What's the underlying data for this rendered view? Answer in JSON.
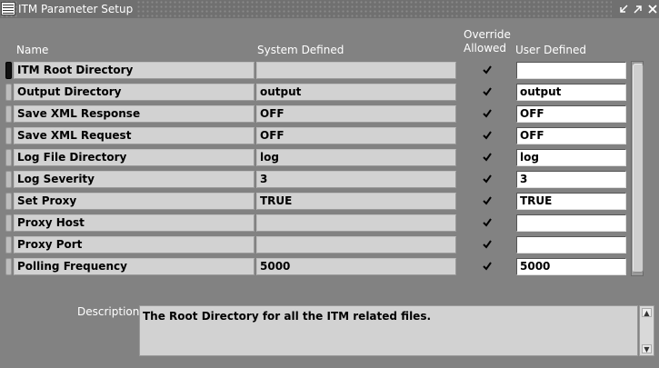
{
  "window": {
    "title": "ITM Parameter Setup",
    "controls": [
      "minimize-icon",
      "maximize-icon",
      "close-icon"
    ]
  },
  "columns": {
    "name": "Name",
    "system": "System Defined",
    "override_line1": "Override",
    "override_line2": "Allowed",
    "user": "User Defined"
  },
  "rows": [
    {
      "name": "ITM Root Directory",
      "system": "",
      "override": true,
      "user": ""
    },
    {
      "name": "Output Directory",
      "system": "output",
      "override": true,
      "user": "output"
    },
    {
      "name": "Save XML Response",
      "system": "OFF",
      "override": true,
      "user": "OFF"
    },
    {
      "name": "Save XML Request",
      "system": "OFF",
      "override": true,
      "user": "OFF"
    },
    {
      "name": "Log File Directory",
      "system": "log",
      "override": true,
      "user": "log"
    },
    {
      "name": "Log Severity",
      "system": "3",
      "override": true,
      "user": "3"
    },
    {
      "name": "Set Proxy",
      "system": "TRUE",
      "override": true,
      "user": "TRUE"
    },
    {
      "name": "Proxy Host",
      "system": "",
      "override": true,
      "user": ""
    },
    {
      "name": "Proxy Port",
      "system": "",
      "override": true,
      "user": ""
    },
    {
      "name": "Polling Frequency",
      "system": "5000",
      "override": true,
      "user": "5000"
    }
  ],
  "description": {
    "label": "Description",
    "text": "The Root Directory for all the ITM related files."
  }
}
